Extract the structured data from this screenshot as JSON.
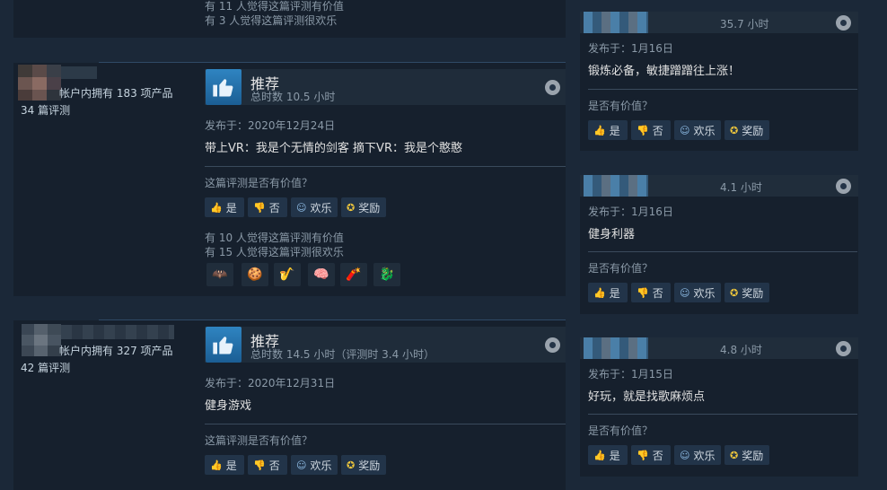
{
  "review0": {
    "helpful_line": "有 11 人觉得这篇评测有价值",
    "funny_line": "有 3 人觉得这篇评测很欢乐"
  },
  "review1": {
    "author_products": "帐户内拥有 183 项产品",
    "author_reviews": "34 篇评测",
    "recommend_label": "推荐",
    "hours": "总时数 10.5 小时",
    "posted": "发布于：2020年12月24日",
    "body": "带上VR：我是个无情的剑客 摘下VR：我是个憨憨",
    "helpful_question": "这篇评测是否有价值？",
    "btn_yes": "是",
    "btn_no": "否",
    "btn_funny": "欢乐",
    "btn_award": "奖励",
    "helpful_line": "有 10 人觉得这篇评测有价值",
    "funny_line": "有 15 人觉得这篇评测很欢乐",
    "award_icons": [
      "🦇",
      "🍪",
      "🎷",
      "🧠",
      "🧨",
      "🐉"
    ]
  },
  "review2": {
    "author_products": "帐户内拥有 327 项产品",
    "author_reviews": "42 篇评测",
    "recommend_label": "推荐",
    "hours": "总时数 14.5 小时（评测时 3.4 小时）",
    "posted": "发布于：2020年12月31日",
    "body": "健身游戏",
    "helpful_question": "这篇评测是否有价值？",
    "btn_yes": "是",
    "btn_no": "否",
    "btn_funny": "欢乐",
    "btn_award": "奖励"
  },
  "side": [
    {
      "hours": "35.7 小时",
      "posted": "发布于：1月16日",
      "body": "锻炼必备，敏捷蹭蹭往上涨！",
      "helpful_question": "是否有价值？",
      "btn_yes": "是",
      "btn_no": "否",
      "btn_funny": "欢乐",
      "btn_award": "奖励"
    },
    {
      "hours": "4.1 小时",
      "posted": "发布于：1月16日",
      "body": "健身利器",
      "helpful_question": "是否有价值？",
      "btn_yes": "是",
      "btn_no": "否",
      "btn_funny": "欢乐",
      "btn_award": "奖励"
    },
    {
      "hours": "4.8 小时",
      "posted": "发布于：1月15日",
      "body": "好玩，就是找歌麻烦点",
      "helpful_question": "是否有价值？",
      "btn_yes": "是",
      "btn_no": "否",
      "btn_funny": "欢乐",
      "btn_award": "奖励"
    }
  ],
  "icons": {
    "thumbs_up": "thumbs-up-icon",
    "thumbs_down": "thumbs-down-icon",
    "smile": "smile-icon",
    "award": "award-icon",
    "steam": "steam-icon"
  },
  "colors": {
    "background": "#1b2838",
    "card": "#16202d",
    "accent_blue": "#2f84c1",
    "award_gold": "#f0c83c"
  }
}
